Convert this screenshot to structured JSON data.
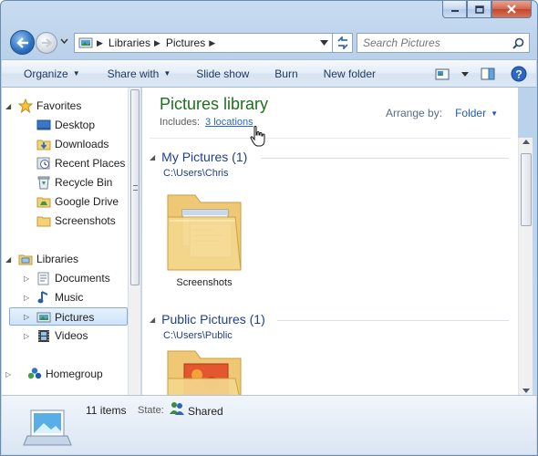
{
  "window": {
    "caption_buttons": [
      "minimize-icon",
      "maximize-icon",
      "close-icon"
    ]
  },
  "address": {
    "breadcrumbs": [
      "Libraries",
      "Pictures"
    ],
    "search_placeholder": "Search Pictures"
  },
  "toolbar": {
    "organize": "Organize",
    "share_with": "Share with",
    "slide_show": "Slide show",
    "burn": "Burn",
    "new_folder": "New folder"
  },
  "nav": {
    "favorites": "Favorites",
    "favorites_items": [
      "Desktop",
      "Downloads",
      "Recent Places",
      "Recycle Bin",
      "Google Drive",
      "Screenshots"
    ],
    "libraries": "Libraries",
    "library_items": [
      "Documents",
      "Music",
      "Pictures",
      "Videos"
    ],
    "homegroup": "Homegroup"
  },
  "library": {
    "title": "Pictures library",
    "includes_label": "Includes:",
    "includes_link": "3 locations",
    "arrange_label": "Arrange by:",
    "arrange_value": "Folder"
  },
  "groups": [
    {
      "title": "My Pictures (1)",
      "path": "C:\\Users\\Chris",
      "items": [
        "Screenshots"
      ]
    },
    {
      "title": "Public Pictures (1)",
      "path": "C:\\Users\\Public",
      "items": [
        ""
      ]
    }
  ],
  "status": {
    "count": "11 items",
    "state_label": "State:",
    "state_value": "Shared"
  }
}
